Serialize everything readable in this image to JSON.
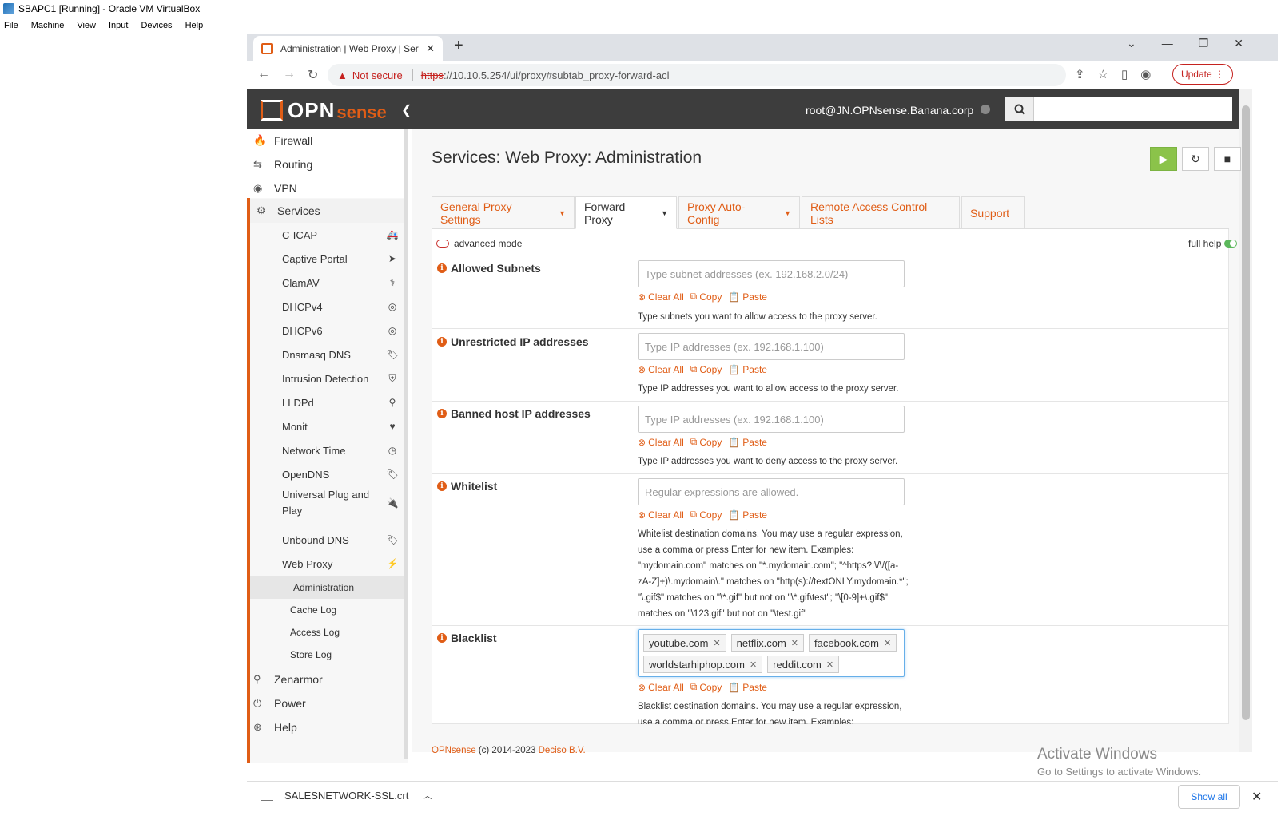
{
  "vbox": {
    "title": "SBAPC1 [Running] - Oracle VM VirtualBox",
    "menu": [
      "File",
      "Machine",
      "View",
      "Input",
      "Devices",
      "Help"
    ]
  },
  "browser": {
    "tab_title": "Administration | Web Proxy | Ser",
    "new_tab": "+",
    "not_secure": "Not secure",
    "url_scheme": "https",
    "url_rest": "://10.10.5.254/ui/proxy#subtab_proxy-forward-acl",
    "update_label": "Update",
    "win_min": "—",
    "win_max": "❐",
    "win_close": "✕",
    "tab_list": "⌄"
  },
  "header": {
    "logo_main": "OPN",
    "logo_accent": "sense",
    "user": "root@JN.OPNsense.Banana.corp"
  },
  "sidebar": {
    "top_items": [
      {
        "label": "Firewall",
        "icon": "fire-icon",
        "glyph": "🔥"
      },
      {
        "label": "Routing",
        "icon": "routing-icon",
        "glyph": "⇆"
      },
      {
        "label": "VPN",
        "icon": "globe-icon",
        "glyph": "◉"
      },
      {
        "label": "Services",
        "icon": "cog-icon",
        "glyph": "⚙"
      }
    ],
    "services": [
      {
        "label": "C-ICAP",
        "icon": "ambulance-icon",
        "glyph": "🚑"
      },
      {
        "label": "Captive Portal",
        "icon": "paper-plane-icon",
        "glyph": "➤"
      },
      {
        "label": "ClamAV",
        "icon": "stethoscope-icon",
        "glyph": "⚕"
      },
      {
        "label": "DHCPv4",
        "icon": "bullseye-icon",
        "glyph": "◎"
      },
      {
        "label": "DHCPv6",
        "icon": "bullseye-icon",
        "glyph": "◎"
      },
      {
        "label": "Dnsmasq DNS",
        "icon": "tags-icon",
        "glyph": "🏷"
      },
      {
        "label": "Intrusion Detection",
        "icon": "shield-icon",
        "glyph": "⛨"
      },
      {
        "label": "LLDPd",
        "icon": "binoculars-icon",
        "glyph": "⚲"
      },
      {
        "label": "Monit",
        "icon": "heartbeat-icon",
        "glyph": "♥"
      },
      {
        "label": "Network Time",
        "icon": "clock-icon",
        "glyph": "◷"
      },
      {
        "label": "OpenDNS",
        "icon": "tags-icon",
        "glyph": "🏷"
      },
      {
        "label": "Universal Plug and Play",
        "icon": "plug-icon",
        "glyph": "🔌"
      },
      {
        "label": "Unbound DNS",
        "icon": "tags-icon",
        "glyph": "🏷"
      },
      {
        "label": "Web Proxy",
        "icon": "bolt-icon",
        "glyph": "⚡"
      }
    ],
    "webproxy_sub": [
      "Administration",
      "Cache Log",
      "Access Log",
      "Store Log"
    ],
    "bottom_items": [
      {
        "label": "Zenarmor",
        "icon": "binoculars-icon",
        "glyph": "⚲"
      },
      {
        "label": "Power",
        "icon": "plug-icon",
        "glyph": "⏻"
      },
      {
        "label": "Help",
        "icon": "life-ring-icon",
        "glyph": "⊛"
      }
    ]
  },
  "page": {
    "title": "Services: Web Proxy: Administration",
    "tabs": [
      {
        "label": "General Proxy Settings",
        "dropdown": true
      },
      {
        "label": "Forward Proxy",
        "dropdown": true
      },
      {
        "label": "Proxy Auto-Config",
        "dropdown": true
      },
      {
        "label": "Remote Access Control Lists",
        "dropdown": false
      },
      {
        "label": "Support",
        "dropdown": false
      }
    ],
    "advanced_mode": "advanced mode",
    "full_help": "full help",
    "actions": {
      "clear": "Clear All",
      "copy": "Copy",
      "paste": "Paste"
    },
    "fields": [
      {
        "label": "Allowed Subnets",
        "placeholder": "Type subnet addresses (ex. 192.168.2.0/24)",
        "help": "Type subnets you want to allow access to the proxy server."
      },
      {
        "label": "Unrestricted IP addresses",
        "placeholder": "Type IP addresses (ex. 192.168.1.100)",
        "help": "Type IP addresses you want to allow access to the proxy server."
      },
      {
        "label": "Banned host IP addresses",
        "placeholder": "Type IP addresses (ex. 192.168.1.100)",
        "help": "Type IP addresses you want to deny access to the proxy server."
      },
      {
        "label": "Whitelist",
        "placeholder": "Regular expressions are allowed.",
        "help": "Whitelist destination domains. You may use a regular expression, use a comma or press Enter for new item. Examples: \"mydomain.com\" matches on \"*.mydomain.com\"; \"^https?:\\/\\/([a-zA-Z]+)\\.mydomain\\.\" matches on \"http(s)://textONLY.mydomain.*\"; \"\\.gif$\" matches on \"\\*.gif\" but not on \"\\*.gif\\test\"; \"\\[0-9]+\\.gif$\" matches on \"\\123.gif\" but not on \"\\test.gif\""
      },
      {
        "label": "Blacklist",
        "chips": [
          "youtube.com",
          "netflix.com",
          "facebook.com",
          "worldstarhiphop.com",
          "reddit.com"
        ],
        "help": "Blacklist destination domains. You may use a regular expression, use a comma or press Enter for new item. Examples:"
      }
    ]
  },
  "footer": {
    "brand": "OPNsense",
    "copyright": "(c) 2014-2023",
    "company": "Deciso B.V."
  },
  "watermark": {
    "line1": "Activate Windows",
    "line2": "Go to Settings to activate Windows."
  },
  "downloads": {
    "file": "SALESNETWORK-SSL.crt",
    "show_all": "Show all"
  },
  "colors": {
    "accent": "#e05d16",
    "header": "#3d3d3d",
    "play": "#8bc34a"
  }
}
